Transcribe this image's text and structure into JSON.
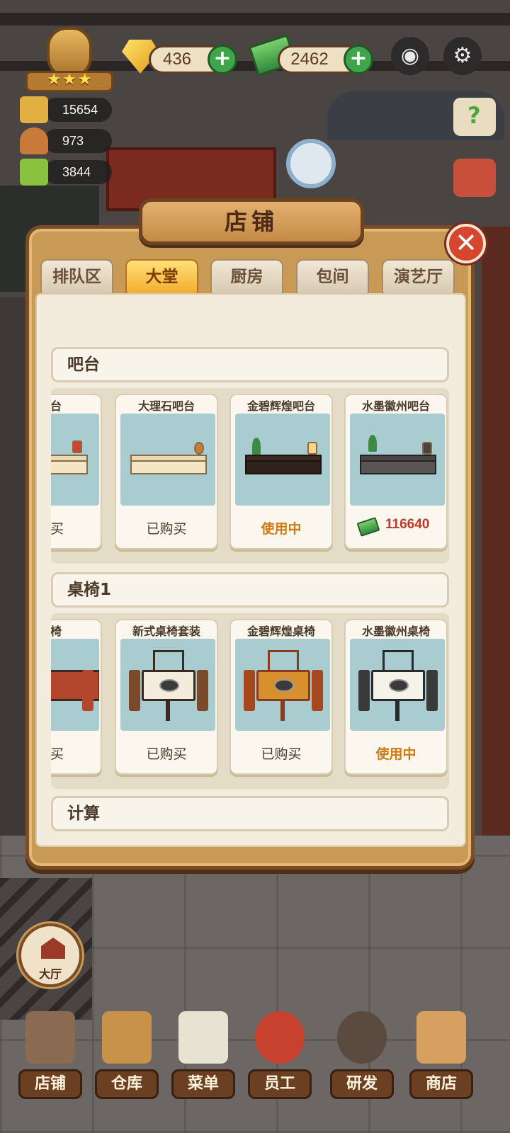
{
  "hud": {
    "gems": "436",
    "cash": "2462",
    "stats": [
      "15654",
      "973",
      "3844"
    ],
    "stars": "★★★"
  },
  "panel": {
    "title": "店铺",
    "close": "✕",
    "tabs": [
      "排队区",
      "大堂",
      "厨房",
      "包间",
      "演艺厅"
    ],
    "active_tab": "大堂"
  },
  "sections": [
    {
      "title": "吧台",
      "items": [
        {
          "name": "吧台",
          "status": "购买"
        },
        {
          "name": "大理石吧台",
          "status": "已购买"
        },
        {
          "name": "金碧辉煌吧台",
          "status": "使用中"
        },
        {
          "name": "水墨徽州吧台",
          "price": "116640"
        }
      ]
    },
    {
      "title": "桌椅1",
      "items": [
        {
          "name": "桌椅",
          "status": "购买"
        },
        {
          "name": "新式桌椅套装",
          "status": "已购买"
        },
        {
          "name": "金碧辉煌桌椅",
          "status": "已购买"
        },
        {
          "name": "水墨徽州桌椅",
          "status": "使用中"
        }
      ]
    },
    {
      "title": "计算"
    }
  ],
  "hall_button": "大厅",
  "bottom_nav": [
    "店铺",
    "仓库",
    "菜单",
    "员工",
    "研发",
    "商店"
  ],
  "colors": {
    "active_tab": "#f2ad2c",
    "in_use": "#d07a16",
    "price": "#c33a2a",
    "close": "#d6452e",
    "plus": "#3fa44a"
  }
}
